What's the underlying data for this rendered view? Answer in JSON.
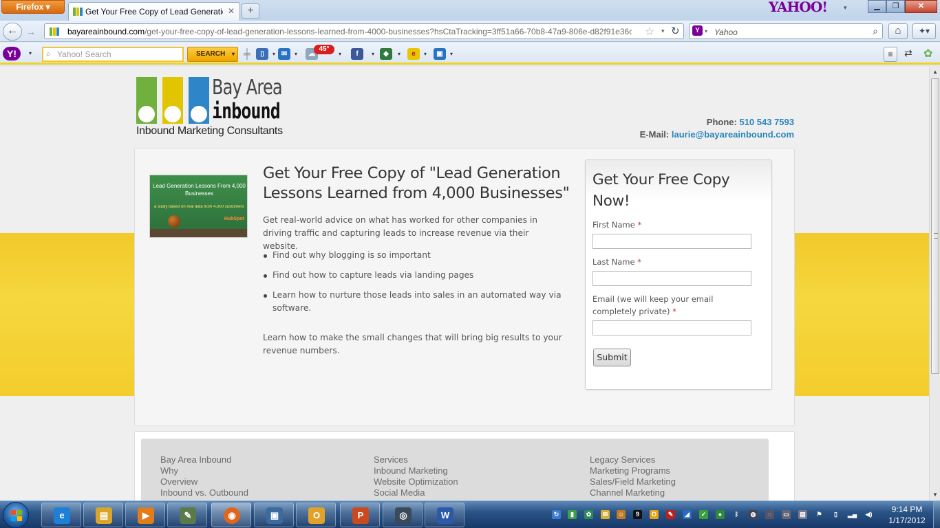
{
  "browser": {
    "app_button": "Firefox",
    "tab_title": "Get Your Free Copy of Lead Generation L...",
    "new_tab": "+",
    "brand": "YAHOO!",
    "url_domain": "bayareainbound.com",
    "url_path": "/get-your-free-copy-of-lead-generation-lessons-learned-from-4000-businesses?hsCtaTracking=3ff51a66-70b8-47a9-806e-d82f91e36c0d|",
    "search_placeholder": "Yahoo",
    "icons": [
      "back-icon",
      "forward-icon",
      "star-icon",
      "reload-icon",
      "search-icon",
      "home-icon",
      "addon-icon"
    ]
  },
  "yahoo_toolbar": {
    "search_placeholder": "Yahoo! Search",
    "search_button": "SEARCH",
    "weather_badge": "45°",
    "tools": [
      {
        "name": "bookmarks-icon",
        "glyph": "▯",
        "color": "#3b6fb6"
      },
      {
        "name": "mail-icon",
        "glyph": "✉",
        "color": "#2a72c4"
      },
      {
        "name": "weather-icon",
        "glyph": "☁",
        "color": "#8fa6bf"
      },
      {
        "name": "facebook-icon",
        "glyph": "f",
        "color": "#3b5998"
      },
      {
        "name": "games-icon",
        "glyph": "◆",
        "color": "#2f7a3c"
      },
      {
        "name": "ebay-icon",
        "glyph": "e",
        "color": "#e8c600"
      },
      {
        "name": "shopping-icon",
        "glyph": "▣",
        "color": "#2a72c4"
      }
    ]
  },
  "site": {
    "logo_line1": "Bay Area",
    "logo_line2": "inbound",
    "logo_tagline": "Inbound Marketing Consultants",
    "phone_label": "Phone:",
    "phone": "510 543 7593",
    "email_label": "E-Mail:",
    "email": "laurie@bayareainbound.com"
  },
  "ebook": {
    "cover_title": "Lead Generation Lessons From 4,000 Businesses",
    "cover_subtitle": "a study based on real data from 4,000 customers",
    "cover_brand": "HubSpot"
  },
  "landing": {
    "title": "Get Your Free Copy of \"Lead Generation Lessons Learned from 4,000 Businesses\"",
    "intro": "Get real-world advice on what has worked for other companies in driving traffic and capturing leads to increase revenue via their website.",
    "bullets": [
      "Find out why blogging is so important",
      "Find out how to capture leads via landing pages",
      "Learn how to nurture those leads into sales in an automated way via software."
    ],
    "outro": "Learn how to make the small changes that will bring big results to your revenue numbers."
  },
  "form": {
    "title": "Get Your Free Copy Now!",
    "first_name_label": "First Name",
    "last_name_label": "Last Name",
    "email_label": "Email (we will keep your email completely private)",
    "required_mark": "*",
    "submit": "Submit"
  },
  "footer": {
    "col1": [
      "Bay Area Inbound",
      "Why",
      "Overview",
      "Inbound vs. Outbound"
    ],
    "col2": [
      "Services",
      "Inbound Marketing",
      "Website Optimization",
      "Social Media"
    ],
    "col3": [
      "Legacy Services",
      "Marketing Programs",
      "Sales/Field Marketing",
      "Channel Marketing"
    ]
  },
  "taskbar": {
    "apps": [
      {
        "name": "internet-explorer-icon",
        "glyph": "e",
        "color": "#1e7fd6"
      },
      {
        "name": "file-explorer-icon",
        "glyph": "▤",
        "color": "#d9a62b"
      },
      {
        "name": "media-player-icon",
        "glyph": "▶",
        "color": "#e07c1a"
      },
      {
        "name": "evernote-icon",
        "glyph": "✎",
        "color": "#5a7a4a"
      },
      {
        "name": "firefox-icon",
        "glyph": "◉",
        "color": "#e0661c"
      },
      {
        "name": "remote-desktop-icon",
        "glyph": "▣",
        "color": "#3a6aa0"
      },
      {
        "name": "outlook-icon",
        "glyph": "O",
        "color": "#e2a22a"
      },
      {
        "name": "powerpoint-icon",
        "glyph": "P",
        "color": "#c94a1e"
      },
      {
        "name": "camera-icon",
        "glyph": "◎",
        "color": "#3a4a5a"
      },
      {
        "name": "word-icon",
        "glyph": "W",
        "color": "#2b5aa8"
      }
    ],
    "tray_number": "9",
    "time": "9:14 PM",
    "date": "1/17/2012"
  }
}
